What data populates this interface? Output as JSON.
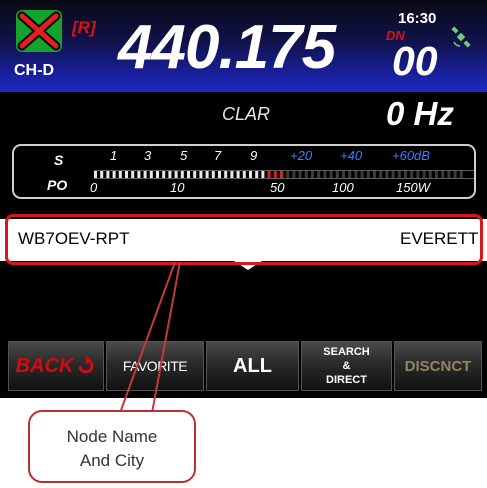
{
  "header": {
    "rpt_tag": "[R]",
    "channel": "CH-D",
    "freq_main": "440.175",
    "freq_decimal": "00",
    "dn_tag": "DN",
    "clock": "16:30",
    "icons": [
      "wires-x-icon",
      "gps-satellite-icon"
    ]
  },
  "clarifier": {
    "label": "CLAR",
    "value": "0 Hz"
  },
  "meter": {
    "s_label": "S",
    "po_label": "PO",
    "s_scale": [
      "1",
      "3",
      "5",
      "7",
      "9",
      "+20",
      "+40",
      "+60dB"
    ],
    "po_scale": [
      "0",
      "10",
      "50",
      "100",
      "150W"
    ]
  },
  "node": {
    "name": "WB7OEV-RPT",
    "city": "EVERETT"
  },
  "buttons": {
    "back": "BACK",
    "favorite": "FAVORITE",
    "all": "ALL",
    "search_line1": "SEARCH",
    "search_line2": "&",
    "search_line3": "DIRECT",
    "disconnect": "DISCNCT"
  },
  "callout": {
    "line1": "Node Name",
    "line2": "And City"
  },
  "colors": {
    "accent_red": "#d9161c",
    "header_blue": "#1d27c8",
    "disconnect_dim": "#8f8566"
  }
}
